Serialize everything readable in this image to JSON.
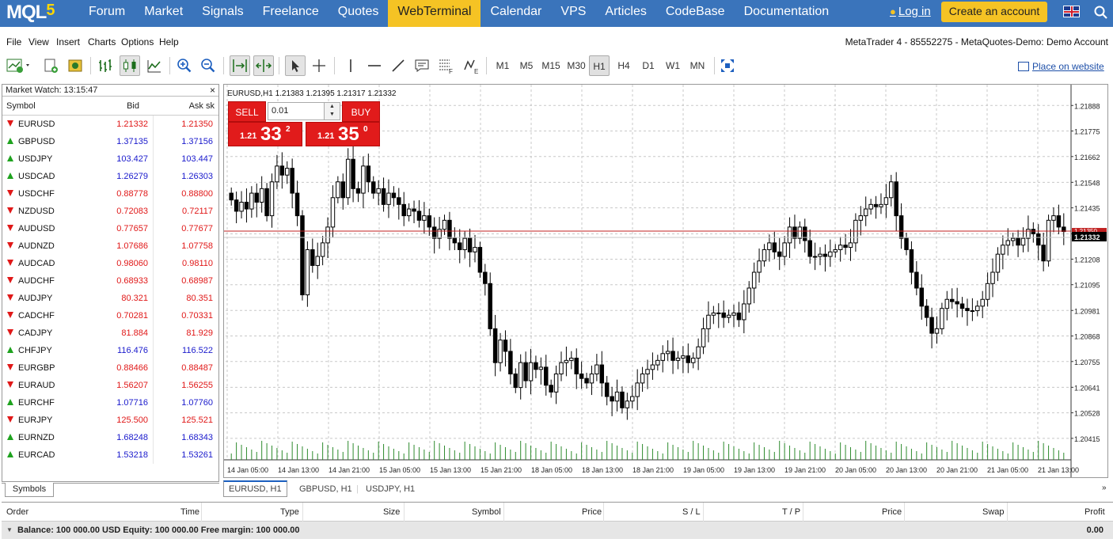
{
  "nav": {
    "logo": "MQL",
    "logo_num": "5",
    "links": [
      "Forum",
      "Market",
      "Signals",
      "Freelance",
      "Quotes",
      "WebTerminal",
      "Calendar",
      "VPS",
      "Articles",
      "CodeBase",
      "Documentation"
    ],
    "active": "WebTerminal",
    "login": "Log in",
    "create": "Create an account"
  },
  "menu": {
    "items": [
      "File",
      "View",
      "Insert",
      "Charts",
      "Options",
      "Help"
    ],
    "account": "MetaTrader 4 - 85552275 - MetaQuotes-Demo: Demo Account"
  },
  "toolbar": {
    "timeframes": [
      "M1",
      "M5",
      "M15",
      "M30",
      "H1",
      "H4",
      "D1",
      "W1",
      "MN"
    ],
    "selected_tf": "H1",
    "place_on_website": "Place on website"
  },
  "market_watch": {
    "title": "Market Watch: 13:15:47",
    "close": "×",
    "col_symbol": "Symbol",
    "col_bid": "Bid",
    "col_ask": "Ask sk",
    "rows": [
      {
        "dir": "down",
        "symbol": "EURUSD",
        "bid": "1.21332",
        "ask": "1.21350",
        "color": "#e01818"
      },
      {
        "dir": "up",
        "symbol": "GBPUSD",
        "bid": "1.37135",
        "ask": "1.37156",
        "color": "#1a1acc"
      },
      {
        "dir": "up",
        "symbol": "USDJPY",
        "bid": "103.427",
        "ask": "103.447",
        "color": "#1a1acc"
      },
      {
        "dir": "up",
        "symbol": "USDCAD",
        "bid": "1.26279",
        "ask": "1.26303",
        "color": "#1a1acc"
      },
      {
        "dir": "down",
        "symbol": "USDCHF",
        "bid": "0.88778",
        "ask": "0.88800",
        "color": "#e01818"
      },
      {
        "dir": "down",
        "symbol": "NZDUSD",
        "bid": "0.72083",
        "ask": "0.72117",
        "color": "#e01818"
      },
      {
        "dir": "down",
        "symbol": "AUDUSD",
        "bid": "0.77657",
        "ask": "0.77677",
        "color": "#e01818"
      },
      {
        "dir": "down",
        "symbol": "AUDNZD",
        "bid": "1.07686",
        "ask": "1.07758",
        "color": "#e01818"
      },
      {
        "dir": "down",
        "symbol": "AUDCAD",
        "bid": "0.98060",
        "ask": "0.98110",
        "color": "#e01818"
      },
      {
        "dir": "down",
        "symbol": "AUDCHF",
        "bid": "0.68933",
        "ask": "0.68987",
        "color": "#e01818"
      },
      {
        "dir": "down",
        "symbol": "AUDJPY",
        "bid": "80.321",
        "ask": "80.351",
        "color": "#e01818"
      },
      {
        "dir": "down",
        "symbol": "CADCHF",
        "bid": "0.70281",
        "ask": "0.70331",
        "color": "#e01818"
      },
      {
        "dir": "down",
        "symbol": "CADJPY",
        "bid": "81.884",
        "ask": "81.929",
        "color": "#e01818"
      },
      {
        "dir": "up",
        "symbol": "CHFJPY",
        "bid": "116.476",
        "ask": "116.522",
        "color": "#1a1acc"
      },
      {
        "dir": "down",
        "symbol": "EURGBP",
        "bid": "0.88466",
        "ask": "0.88487",
        "color": "#e01818"
      },
      {
        "dir": "down",
        "symbol": "EURAUD",
        "bid": "1.56207",
        "ask": "1.56255",
        "color": "#e01818"
      },
      {
        "dir": "up",
        "symbol": "EURCHF",
        "bid": "1.07716",
        "ask": "1.07760",
        "color": "#1a1acc"
      },
      {
        "dir": "down",
        "symbol": "EURJPY",
        "bid": "125.500",
        "ask": "125.521",
        "color": "#e01818"
      },
      {
        "dir": "up",
        "symbol": "EURNZD",
        "bid": "1.68248",
        "ask": "1.68343",
        "color": "#1a1acc"
      },
      {
        "dir": "up",
        "symbol": "EURCAD",
        "bid": "1.53218",
        "ask": "1.53261",
        "color": "#1a1acc"
      }
    ],
    "tab": "Symbols"
  },
  "trade": {
    "sell": "SELL",
    "buy": "BUY",
    "lot": "0.01",
    "sell_pre": "1.21",
    "sell_main": "33",
    "sell_sup": "2",
    "buy_pre": "1.21",
    "buy_main": "35",
    "buy_sup": "0"
  },
  "chart_tabs": [
    "EURUSD, H1",
    "GBPUSD, H1",
    "USDJPY, H1"
  ],
  "chart_data": {
    "type": "candlestick",
    "header": "EURUSD,H1  1.21383 1.21395 1.21317 1.21332",
    "current_price": "1.21332",
    "current_price_value": 1.21332,
    "ask_line_label": "1.21350",
    "ylim": [
      1.2032,
      1.2198
    ],
    "y_ticks": [
      "1.21888",
      "1.21775",
      "1.21662",
      "1.21548",
      "1.21435",
      "1.21320",
      "1.21208",
      "1.21095",
      "1.20981",
      "1.20868",
      "1.20755",
      "1.20641",
      "1.20528",
      "1.20415"
    ],
    "x_ticks": [
      "14 Jan 05:00",
      "14 Jan 13:00",
      "14 Jan 21:00",
      "15 Jan 05:00",
      "15 Jan 13:00",
      "15 Jan 21:00",
      "18 Jan 05:00",
      "18 Jan 13:00",
      "18 Jan 21:00",
      "19 Jan 05:00",
      "19 Jan 13:00",
      "19 Jan 21:00",
      "20 Jan 05:00",
      "20 Jan 13:00",
      "20 Jan 21:00",
      "21 Jan 05:00",
      "21 Jan 13:00"
    ],
    "candles": [
      1.2147,
      1.2142,
      1.2146,
      1.2143,
      1.215,
      1.2146,
      1.2152,
      1.214,
      1.2155,
      1.2162,
      1.2158,
      1.2161,
      1.215,
      1.214,
      1.2105,
      1.2125,
      1.2118,
      1.2122,
      1.2128,
      1.2135,
      1.2148,
      1.2155,
      1.2148,
      1.2165,
      1.2152,
      1.215,
      1.2162,
      1.2155,
      1.215,
      1.2152,
      1.2145,
      1.215,
      1.2148,
      1.2145,
      1.214,
      1.2143,
      1.2142,
      1.2138,
      1.214,
      1.2135,
      1.213,
      1.2134,
      1.2138,
      1.213,
      1.2128,
      1.2125,
      1.213,
      1.2124,
      1.2126,
      1.2115,
      1.211,
      1.209,
      1.2075,
      1.2085,
      1.208,
      1.207,
      1.2064,
      1.2075,
      1.2067,
      1.2075,
      1.2072,
      1.2073,
      1.2065,
      1.2062,
      1.207,
      1.2075,
      1.2076,
      1.2077,
      1.207,
      1.2068,
      1.2066,
      1.207,
      1.2074,
      1.2066,
      1.206,
      1.2058,
      1.2062,
      1.2055,
      1.2058,
      1.206,
      1.2066,
      1.207,
      1.2072,
      1.2074,
      1.2076,
      1.2079,
      1.208,
      1.2076,
      1.2077,
      1.2078,
      1.2075,
      1.2077,
      1.2082,
      1.209,
      1.2096,
      1.2097,
      1.2097,
      1.2095,
      1.2096,
      1.2097,
      1.2094,
      1.2101,
      1.2108,
      1.2115,
      1.212,
      1.2125,
      1.2128,
      1.2124,
      1.2122,
      1.2128,
      1.2135,
      1.213,
      1.2135,
      1.2129,
      1.2122,
      1.2122,
      1.2123,
      1.2122,
      1.2124,
      1.2125,
      1.2127,
      1.2126,
      1.2128,
      1.2138,
      1.214,
      1.2143,
      1.2145,
      1.2144,
      1.2145,
      1.2148,
      1.2155,
      1.214,
      1.213,
      1.2125,
      1.2115,
      1.2108,
      1.21,
      1.2095,
      1.2088,
      1.209,
      1.2099,
      1.2103,
      1.2102,
      1.2101,
      1.2099,
      1.2098,
      1.2098,
      1.21,
      1.2103,
      1.211,
      1.2115,
      1.2123,
      1.2127,
      1.2129,
      1.213,
      1.2127,
      1.213,
      1.2134,
      1.2132,
      1.2127,
      1.212,
      1.2138,
      1.214,
      1.2135,
      1.2133
    ],
    "volume_note": "volume histogram"
  },
  "bottom": {
    "cols": [
      "Order",
      "Time",
      "Type",
      "Size",
      "Symbol",
      "Price",
      "S / L",
      "T / P",
      "Price",
      "Swap",
      "Profit"
    ],
    "balance": "Balance: 100 000.00 USD  Equity: 100 000.00  Free margin: 100 000.00",
    "profit": "0.00"
  }
}
